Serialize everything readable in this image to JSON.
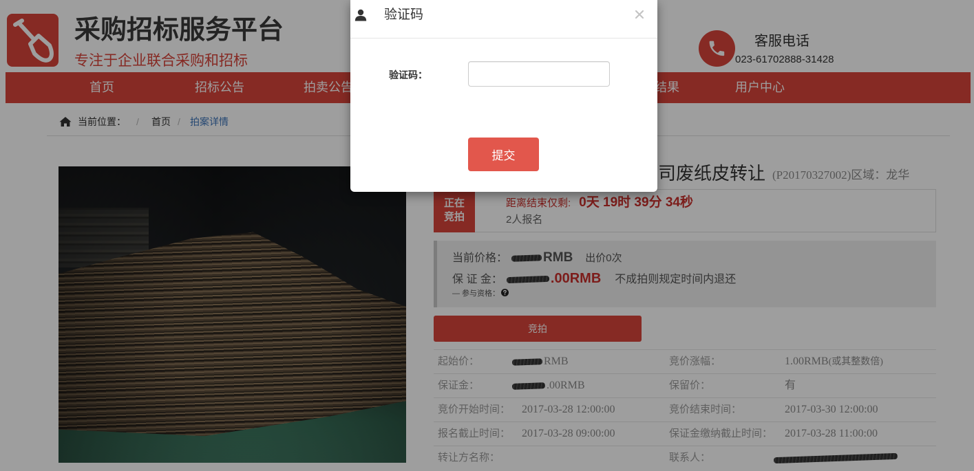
{
  "colors": {
    "brand_red": "#d9443a",
    "modal_button_red": "#e2574c",
    "link_blue": "#3b73b9",
    "alert_red": "#c9302c",
    "backdrop": "rgba(0,0,0,0.38)"
  },
  "header": {
    "logo_icon": "shovel-icon",
    "title": "采购招标服务平台",
    "subtitle": "专注于企业联合采购和招标",
    "hotline_icon": "phone-icon",
    "hotline_label": "客服电话",
    "hotline_number": "023-61702888-31428"
  },
  "nav": {
    "items": [
      "首页",
      "招标公告",
      "拍卖公告",
      "结果",
      "用户中心"
    ]
  },
  "breadcrumb": {
    "icon": "home-icon",
    "prefix": "当前位置：",
    "separator": "/",
    "items": [
      "首页",
      "拍案详情"
    ]
  },
  "auction": {
    "title": "司废纸皮转让",
    "code_region": "(P20170327002)区域：龙华",
    "status_badge": {
      "line1": "正在",
      "line2": "竞拍"
    },
    "countdown_label": "距离结束仅剩:",
    "countdown_value": "0天 19时 39分 34秒",
    "signup_count": "2人报名",
    "price_box": {
      "current_price_label": "当前价格：",
      "current_price_visible": "RMB",
      "bid_count": "出价0次",
      "deposit_label": "保 证 金：",
      "deposit_visible": ".00RMB",
      "deposit_note": "不成拍则规定时间内退还",
      "eligibility_label": "— 参与资格：",
      "eligibility_icon": "question-circle-icon"
    },
    "bid_button_label": "竞拍"
  },
  "details": {
    "rows": [
      {
        "label_left": "起始价：",
        "value_left": "RMB",
        "label_right": "竞价涨幅：",
        "value_right": "1.00RMB",
        "value_right_note": "(或其整数倍)"
      },
      {
        "label_left": "保证金：",
        "value_left": ".00RMB",
        "label_right": "保留价：",
        "value_right": "有"
      },
      {
        "label_left": "竞价开始时间：",
        "value_left": "2017-03-28 12:00:00",
        "label_right": "竞价结束时间：",
        "value_right": "2017-03-30 12:00:00"
      },
      {
        "label_left": "报名截止时间：",
        "value_left": "2017-03-28 09:00:00",
        "label_right": "保证金缴纳截止时间：",
        "value_right": "2017-03-28 11:00:00"
      },
      {
        "label_left": "转让方名称：",
        "value_left": "",
        "label_right": "联系人：",
        "value_right": ""
      }
    ]
  },
  "modal": {
    "title_icon": "user-icon",
    "title": "验证码",
    "close_icon": "close-icon",
    "field_label": "验证码：",
    "field_value": "",
    "submit_label": "提交"
  }
}
